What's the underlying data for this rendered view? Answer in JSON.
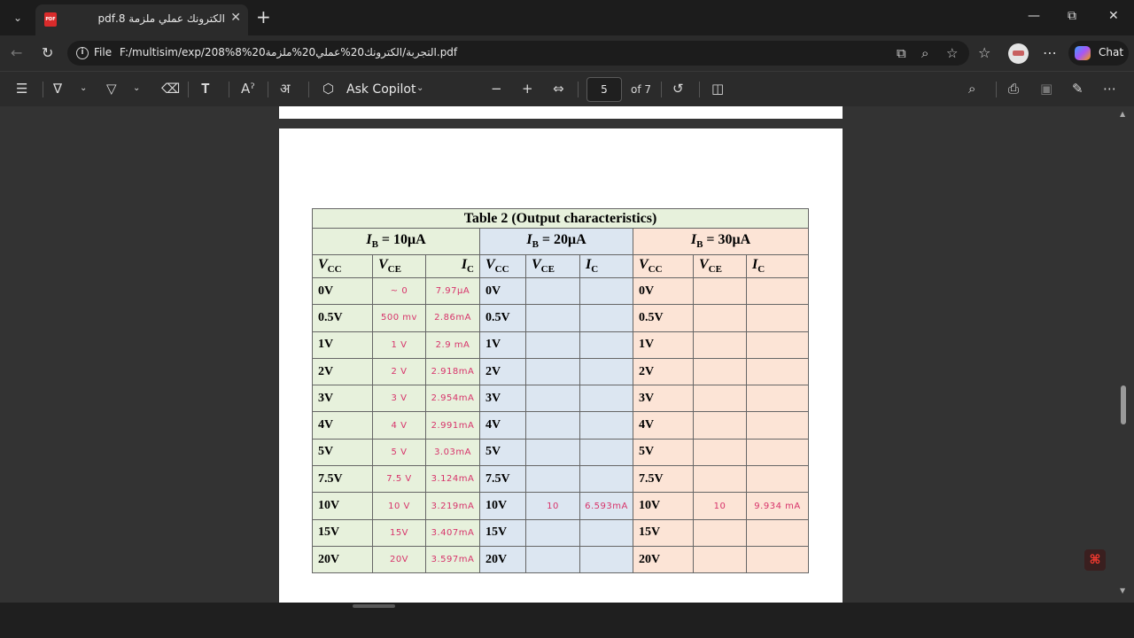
{
  "tab": {
    "title": "الكترونك عملي ملزمة 8.pdf",
    "icon_label": "PDF"
  },
  "address": {
    "scheme_label": "File",
    "url": "F:/multisim/exp/208%التجربة/الكترونك20%عملي20%ملزمة20%8.pdf"
  },
  "chat": {
    "label": "Chat"
  },
  "pdf_toolbar": {
    "ask_copilot_label": "Ask Copilot",
    "page_current": "5",
    "page_of": "of 7"
  },
  "table": {
    "title": "Table 2 (Output characteristics)",
    "groups": [
      {
        "ib_symbol": "I",
        "ib_subscript": "B",
        "ib_value": " = 10μA"
      },
      {
        "ib_symbol": "I",
        "ib_subscript": "B",
        "ib_value": " = 20μA"
      },
      {
        "ib_symbol": "I",
        "ib_subscript": "B",
        "ib_value": " = 30μA"
      }
    ],
    "col_headers": {
      "vcc": "V",
      "vcc_sub": "CC",
      "vce": "V",
      "vce_sub": "CE",
      "ic": "I",
      "ic_sub": "C"
    },
    "rows": [
      {
        "vcc": "0V",
        "g1_vce": "~ 0",
        "g1_ic": "7.97μA",
        "g2_vce": "",
        "g2_ic": "",
        "g3_vce": "",
        "g3_ic": ""
      },
      {
        "vcc": "0.5V",
        "g1_vce": "500 mv",
        "g1_ic": "2.86mA",
        "g2_vce": "",
        "g2_ic": "",
        "g3_vce": "",
        "g3_ic": ""
      },
      {
        "vcc": "1V",
        "g1_vce": "1 V",
        "g1_ic": "2.9 mA",
        "g2_vce": "",
        "g2_ic": "",
        "g3_vce": "",
        "g3_ic": ""
      },
      {
        "vcc": "2V",
        "g1_vce": "2 V",
        "g1_ic": "2.918mA",
        "g2_vce": "",
        "g2_ic": "",
        "g3_vce": "",
        "g3_ic": ""
      },
      {
        "vcc": "3V",
        "g1_vce": "3 V",
        "g1_ic": "2.954mA",
        "g2_vce": "",
        "g2_ic": "",
        "g3_vce": "",
        "g3_ic": ""
      },
      {
        "vcc": "4V",
        "g1_vce": "4 V",
        "g1_ic": "2.991mA",
        "g2_vce": "",
        "g2_ic": "",
        "g3_vce": "",
        "g3_ic": ""
      },
      {
        "vcc": "5V",
        "g1_vce": "5 V",
        "g1_ic": "3.03mA",
        "g2_vce": "",
        "g2_ic": "",
        "g3_vce": "",
        "g3_ic": ""
      },
      {
        "vcc": "7.5V",
        "g1_vce": "7.5 V",
        "g1_ic": "3.124mA",
        "g2_vce": "",
        "g2_ic": "",
        "g3_vce": "",
        "g3_ic": ""
      },
      {
        "vcc": "10V",
        "g1_vce": "10 V",
        "g1_ic": "3.219mA",
        "g2_vce": "10",
        "g2_ic": "6.593mA",
        "g3_vce": "10",
        "g3_ic": "9.934 mA"
      },
      {
        "vcc": "15V",
        "g1_vce": "15V",
        "g1_ic": "3.407mA",
        "g2_vce": "",
        "g2_ic": "",
        "g3_vce": "",
        "g3_ic": ""
      },
      {
        "vcc": "20V",
        "g1_vce": "20V",
        "g1_ic": "3.597mA",
        "g2_vce": "",
        "g2_ic": "",
        "g3_vce": "",
        "g3_ic": ""
      }
    ]
  },
  "accent": {
    "acrobat_red": "#ff3b30",
    "handwriting": "#d7336a",
    "group1_bg": "#e7f1dc",
    "group2_bg": "#dce6f1",
    "group3_bg": "#fce4d6"
  }
}
